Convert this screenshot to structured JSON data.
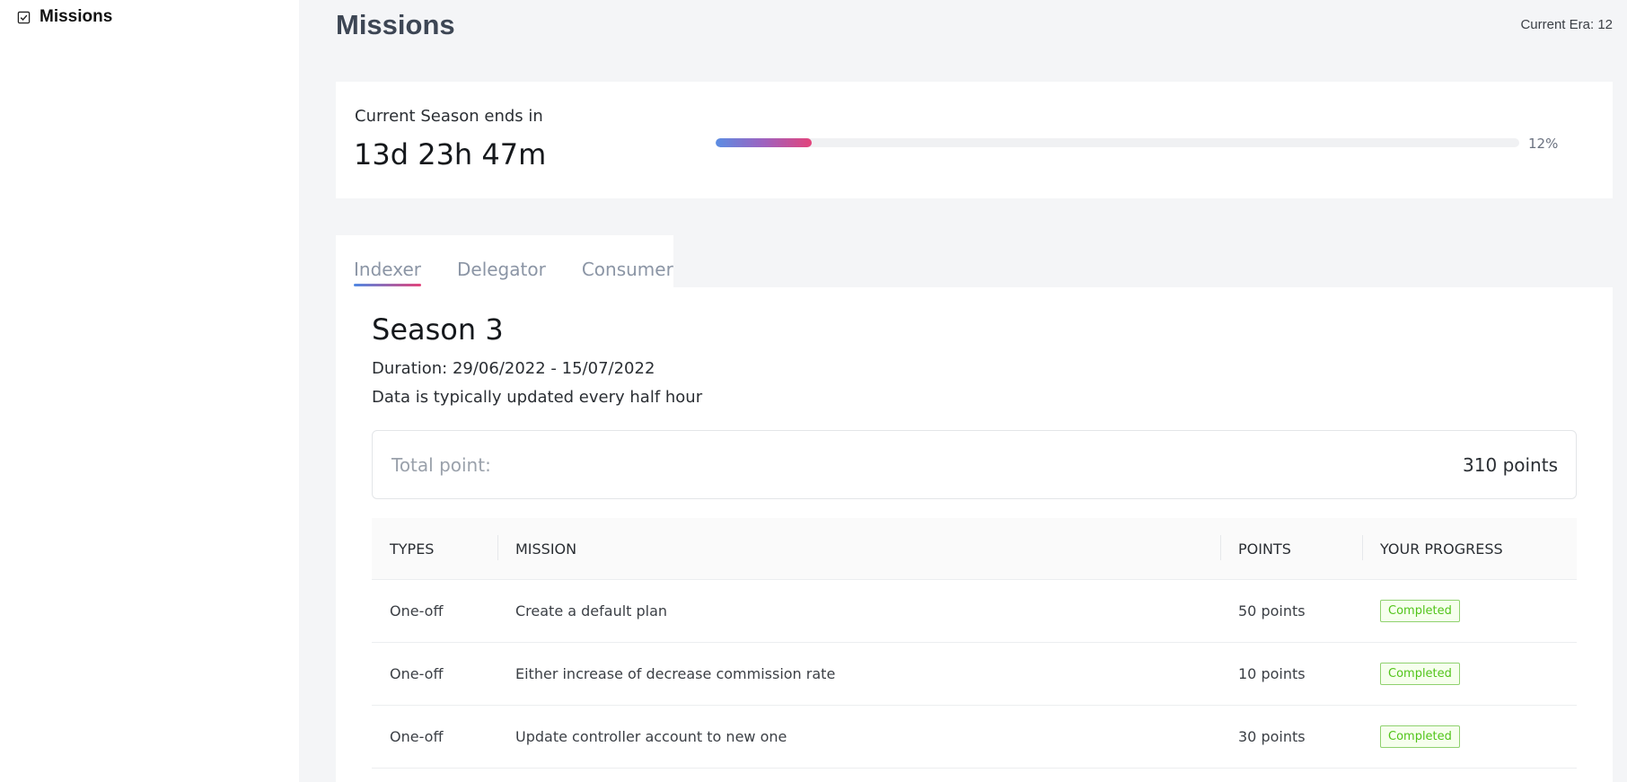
{
  "sidebar": {
    "items": [
      {
        "label": "Missions",
        "icon": "checkbox-icon"
      }
    ]
  },
  "header": {
    "title": "Missions",
    "era": "Current Era: 12"
  },
  "season_card": {
    "label": "Current Season ends in",
    "countdown": "13d 23h 47m",
    "progress_percent": 12,
    "progress_text": "12%"
  },
  "tabs": [
    {
      "label": "Indexer",
      "active": true
    },
    {
      "label": "Delegator",
      "active": false
    },
    {
      "label": "Consumer",
      "active": false
    }
  ],
  "season": {
    "title": "Season 3",
    "duration": "Duration: 29/06/2022 - 15/07/2022",
    "note": "Data is typically updated every half hour",
    "total_label": "Total point:",
    "total_value": "310 points"
  },
  "table": {
    "headers": [
      "TYPES",
      "MISSION",
      "POINTS",
      "YOUR PROGRESS"
    ],
    "rows": [
      {
        "type": "One-off",
        "mission": "Create a default plan",
        "points": "50 points",
        "progress": "Completed"
      },
      {
        "type": "One-off",
        "mission": "Either increase of decrease commission rate",
        "points": "10 points",
        "progress": "Completed"
      },
      {
        "type": "One-off",
        "mission": "Update controller account to new one",
        "points": "30 points",
        "progress": "Completed"
      }
    ]
  },
  "colors": {
    "accent_start": "#5b8de3",
    "accent_end": "#e3447b",
    "completed": "#52c41a"
  }
}
